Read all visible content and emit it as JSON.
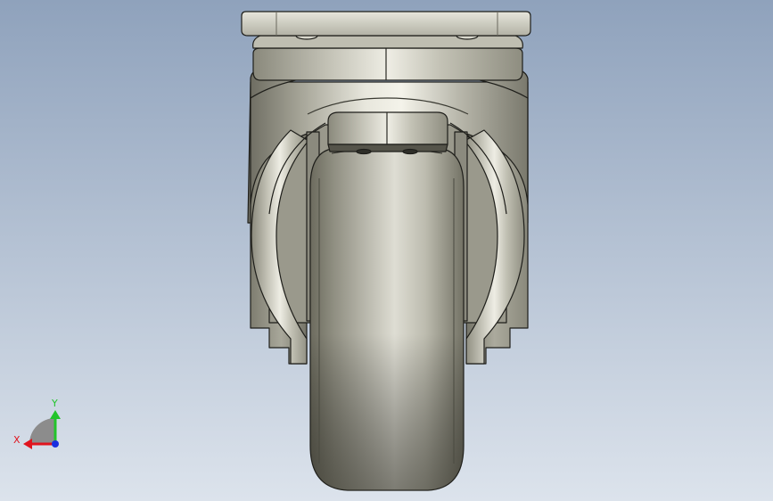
{
  "viewport": {
    "background_top": "#8FA2BC",
    "background_bottom": "#DCE3EC"
  },
  "triad": {
    "x_label": "X",
    "y_label": "Y",
    "x_color": "#E0141E",
    "y_color": "#22C42A",
    "z_color": "#1A2FE0"
  },
  "model": {
    "name": "caster-wheel-assembly",
    "view": "front"
  }
}
